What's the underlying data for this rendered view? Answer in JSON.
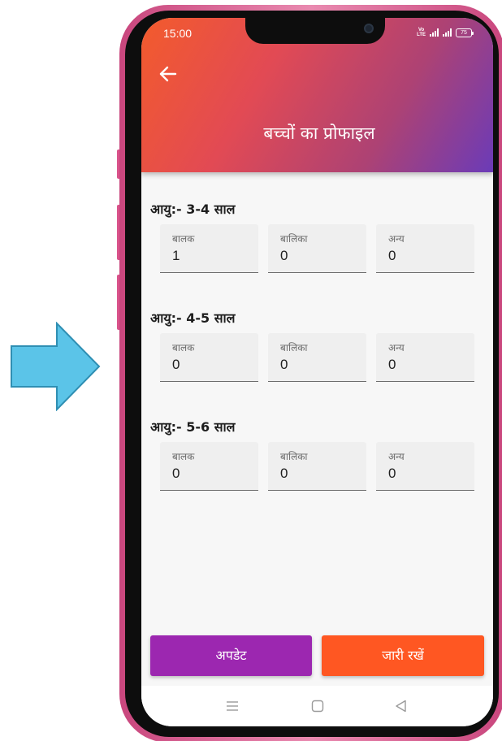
{
  "status_bar": {
    "time": "15:00",
    "volte_line1": "Vo",
    "volte_line2": "LTE",
    "battery": "75"
  },
  "header": {
    "title": "बच्चों का प्रोफाइल"
  },
  "field_labels": {
    "boys": "बालक",
    "girls": "बालिका",
    "other": "अन्य"
  },
  "age_groups": [
    {
      "title": "आयु:- 3-4 साल",
      "boys": "1",
      "girls": "0",
      "other": "0"
    },
    {
      "title": "आयु:- 4-5 साल",
      "boys": "0",
      "girls": "0",
      "other": "0"
    },
    {
      "title": "आयु:- 5-6 साल",
      "boys": "0",
      "girls": "0",
      "other": "0"
    }
  ],
  "buttons": {
    "update": "अपडेट",
    "continue": "जारी रखें"
  },
  "colors": {
    "update_button": "#9c27b0",
    "continue_button": "#ff5722",
    "header_gradient_start": "#f35b2c",
    "header_gradient_end": "#6b3bb8",
    "pointer_arrow": "#5bc4e8",
    "phone_frame": "#d9528a"
  },
  "icons": {
    "back": "arrow-left-icon",
    "pointer": "right-arrow-pointer-icon",
    "nav": [
      "menu-icon",
      "home-square-icon",
      "back-triangle-icon"
    ]
  }
}
